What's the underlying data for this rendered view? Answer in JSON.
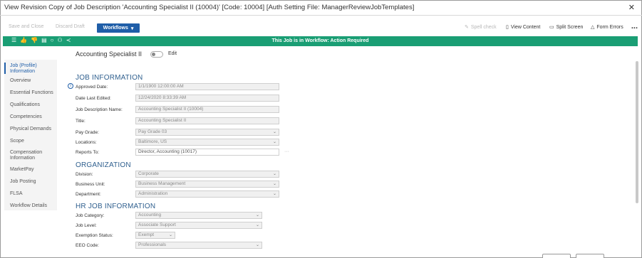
{
  "window": {
    "title": "View Revision Copy of Job Description 'Accounting Specialist II (10004)' [Code: 10004] [Auth Setting File: ManagerReviewJobTemplates]",
    "close_icon": "close-icon"
  },
  "toolbar": {
    "save_close": "Save and Close",
    "discard_draft": "Discard Draft",
    "workflows": "Workflows",
    "spell_check": "Spell check",
    "view_content": "View Content",
    "split_screen": "Split Screen",
    "form_errors": "Form Errors",
    "more": "..."
  },
  "banner": {
    "message": "This Job is in Workflow: Action Required",
    "color": "#1a9e74"
  },
  "sidebar": {
    "items": [
      {
        "label": "Job (Profile) Information"
      },
      {
        "label": "Overview"
      },
      {
        "label": "Essential Functions"
      },
      {
        "label": "Qualifications"
      },
      {
        "label": "Competencies"
      },
      {
        "label": "Physical Demands"
      },
      {
        "label": "Scope"
      },
      {
        "label": "Compensation Information"
      },
      {
        "label": "MarketPay"
      },
      {
        "label": "Job Posting"
      },
      {
        "label": "FLSA"
      },
      {
        "label": "Workflow Details"
      }
    ]
  },
  "header": {
    "job_name": "Accounting Specialist II",
    "edit_label": "Edit"
  },
  "job_info": {
    "heading": "JOB INFORMATION",
    "approved_date_label": "Approved Date:",
    "approved_date": "1/1/1900 12:00:00 AM",
    "last_edited_label": "Date Last Edited:",
    "last_edited": "12/24/2020 8:33:39 AM",
    "desc_name_label": "Job Description Name:",
    "desc_name": "Accounting Specialist II (10004)",
    "title_label": "Title:",
    "title": "Accounting Specialist II",
    "pay_grade_label": "Pay Grade:",
    "pay_grade": "Pay Grade 03",
    "locations_label": "Locations:",
    "locations": "Baltimore, US",
    "reports_to_label": "Reports To:",
    "reports_to": "Director, Accounting (10017)"
  },
  "organization": {
    "heading": "ORGANIZATION",
    "division_label": "Division:",
    "division": "Corporate",
    "business_unit_label": "Business Unit:",
    "business_unit": "Business Management",
    "department_label": "Department:",
    "department": "Administration"
  },
  "hr_info": {
    "heading": "HR JOB INFORMATION",
    "category_label": "Job Category:",
    "category": "Accounting",
    "level_label": "Job Level:",
    "level": "Associate Support",
    "exemption_label": "Exemption Status:",
    "exemption": "Exempt",
    "eeo_label": "EEO Code:",
    "eeo": "Professionals"
  }
}
